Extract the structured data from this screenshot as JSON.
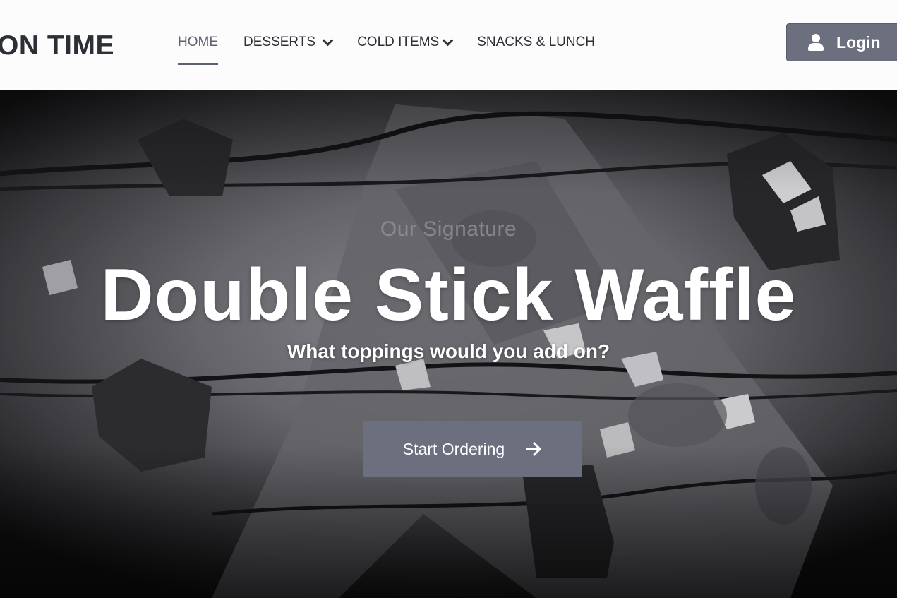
{
  "header": {
    "brand": "ON TIME",
    "nav": [
      {
        "label": "HOME",
        "active": true,
        "has_dropdown": false
      },
      {
        "label": "DESSERTS",
        "active": false,
        "has_dropdown": true
      },
      {
        "label": "COLD ITEMS",
        "active": false,
        "has_dropdown": true
      },
      {
        "label": "SNACKS & LUNCH",
        "active": false,
        "has_dropdown": false
      }
    ],
    "login": {
      "label": "Login",
      "icon": "user-icon"
    }
  },
  "hero": {
    "eyebrow": "Our Signature",
    "headline": "Double Stick Waffle",
    "subline": "What toppings would you add on?",
    "cta": {
      "label": "Start Ordering",
      "icon": "arrow-right-icon"
    }
  },
  "colors": {
    "accent": "#6b6f7e",
    "nav_text": "#2c2f36",
    "nav_active": "#5d6273",
    "header_bg": "#fdfcfc"
  }
}
